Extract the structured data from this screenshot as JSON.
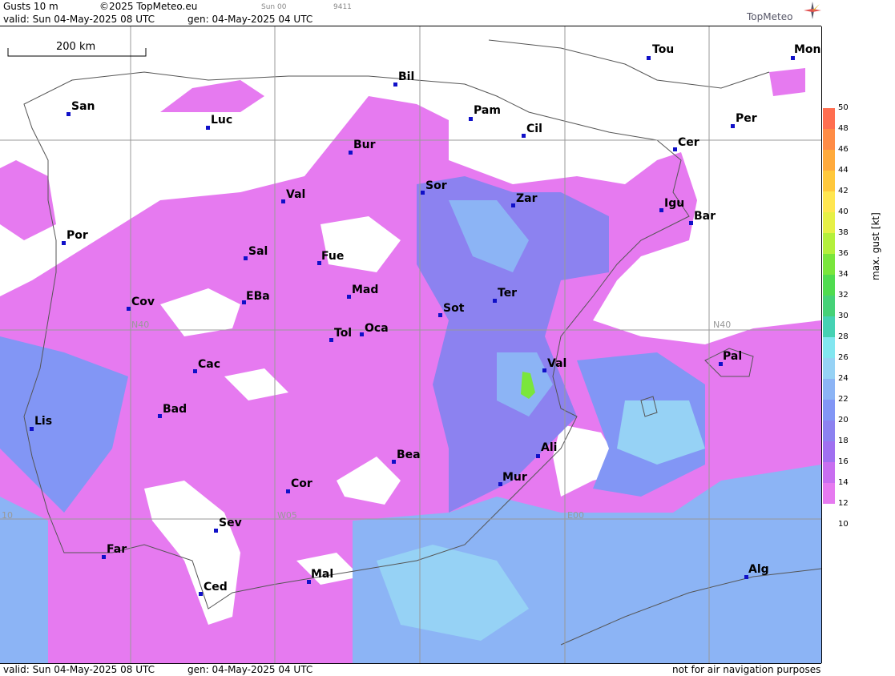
{
  "header": {
    "product": "Gusts 10 m",
    "copyright": "©2025 TopMeteo.eu",
    "run_short": "Sun 00",
    "code": "9411",
    "valid": "valid:  Sun  04-May-2025  08 UTC",
    "gen": "gen: 04-May-2025 04 UTC",
    "brand": "TopMeteo"
  },
  "scale_bar": {
    "label": "200 km"
  },
  "legend": {
    "unit": "max. gust  [kt]",
    "ticks": [
      "50",
      "48",
      "46",
      "44",
      "42",
      "40",
      "38",
      "36",
      "34",
      "32",
      "30",
      "28",
      "26",
      "24",
      "22",
      "20",
      "18",
      "16",
      "14",
      "12",
      "10"
    ],
    "colors": [
      "#ff6e50",
      "#ff8c46",
      "#ffaa3c",
      "#ffc83c",
      "#ffe650",
      "#e6f046",
      "#b4f03c",
      "#7ae63c",
      "#50dc50",
      "#46d278",
      "#46d2b4",
      "#82e6f0",
      "#96d2f5",
      "#8cb4f5",
      "#8296f5",
      "#8c82f0",
      "#a070f0",
      "#c86ef0",
      "#e67af0",
      "#e5e5f5"
    ]
  },
  "grid_labels": {
    "n40_left": "N40",
    "n40_right": "N40",
    "w05": "W05",
    "e00": "E00",
    "w10": "10"
  },
  "cities": [
    {
      "name": "Bil"
    },
    {
      "name": "Tou"
    },
    {
      "name": "Mon"
    },
    {
      "name": "San"
    },
    {
      "name": "Pam"
    },
    {
      "name": "Luc"
    },
    {
      "name": "Per"
    },
    {
      "name": "Cil"
    },
    {
      "name": "Bur"
    },
    {
      "name": "Cer"
    },
    {
      "name": "Sor"
    },
    {
      "name": "Val"
    },
    {
      "name": "Zar"
    },
    {
      "name": "Igu"
    },
    {
      "name": "Bar"
    },
    {
      "name": "Por"
    },
    {
      "name": "Sal"
    },
    {
      "name": "Fue"
    },
    {
      "name": "Mad"
    },
    {
      "name": "Ter"
    },
    {
      "name": "Cov"
    },
    {
      "name": "EBa"
    },
    {
      "name": "Sot"
    },
    {
      "name": "Tol"
    },
    {
      "name": "Oca"
    },
    {
      "name": "Pal"
    },
    {
      "name": "Cac"
    },
    {
      "name": "Val"
    },
    {
      "name": "Lis"
    },
    {
      "name": "Bad"
    },
    {
      "name": "Ali"
    },
    {
      "name": "Bea"
    },
    {
      "name": "Cor"
    },
    {
      "name": "Mur"
    },
    {
      "name": "Sev"
    },
    {
      "name": "Far"
    },
    {
      "name": "Alg"
    },
    {
      "name": "Mal"
    },
    {
      "name": "Ced"
    }
  ],
  "footer": {
    "valid": "valid:  Sun  04-May-2025  08 UTC",
    "gen": "gen: 04-May-2025 04 UTC",
    "note": "not for air navigation purposes"
  }
}
